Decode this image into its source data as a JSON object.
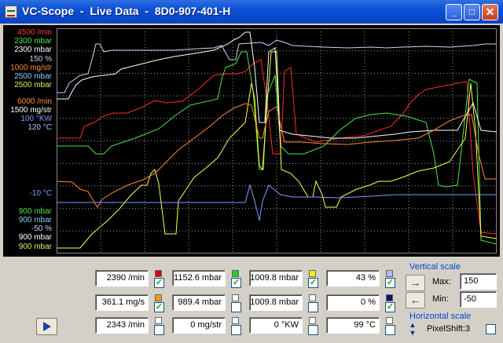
{
  "window": {
    "title": "VC-Scope  -  Live Data  -  8D0-907-401-H",
    "minimize_symbol": "_",
    "maximize_symbol": "□",
    "close_symbol": "✕"
  },
  "scale_labels": [
    {
      "text": "4500 /min",
      "color": "#ff3b3b"
    },
    {
      "text": "2300 mbar",
      "color": "#49e849"
    },
    {
      "text": "2300 mbar",
      "color": "#ffffff"
    },
    {
      "text": "150 %",
      "color": "#d0d0ff"
    },
    {
      "text": "1000 mg/str",
      "color": "#ff8c2a"
    },
    {
      "text": "2500 mbar",
      "color": "#7fd0ff"
    },
    {
      "text": "2500 mbar",
      "color": "#e8e85a"
    },
    {
      "text": "6000 /min",
      "color": "#ff8c2a"
    },
    {
      "text": "1500 mg/str",
      "color": "#ffffff"
    },
    {
      "text": "100 °KW",
      "color": "#7aa0ff"
    },
    {
      "text": "120 °C",
      "color": "#b0c8ff"
    },
    {
      "text": "-10 °C",
      "color": "#7aa0ff"
    },
    {
      "text": "900 mbar",
      "color": "#49e849"
    },
    {
      "text": "900 mbar",
      "color": "#7fd0ff"
    },
    {
      "text": "-50 %",
      "color": "#d0d0ff"
    },
    {
      "text": "900 mbar",
      "color": "#ffffff"
    },
    {
      "text": "900 mbar",
      "color": "#e8e85a"
    }
  ],
  "readouts": [
    {
      "value": "2390 /min",
      "color": "#e00000",
      "checked": true
    },
    {
      "value": "1152.6 mbar",
      "color": "#22d022",
      "checked": true
    },
    {
      "value": "1009.8 mbar",
      "color": "#f0f000",
      "checked": true
    },
    {
      "value": "43 %",
      "color": "#b8b8f0",
      "checked": true
    },
    {
      "value": "361.1 mg/s",
      "color": "#f0a000",
      "checked": true
    },
    {
      "value": "989.4 mbar",
      "color": "#ffffff",
      "checked": false
    },
    {
      "value": "1009.8 mbar",
      "color": "#ffffff",
      "checked": false
    },
    {
      "value": "0 %",
      "color": "#101060",
      "checked": true
    },
    {
      "value": "2343 /min",
      "color": "#ffffff",
      "checked": false
    },
    {
      "value": "0 mg/str",
      "color": "#ffffff",
      "checked": false
    },
    {
      "value": "0 °KW",
      "color": "#ffffff",
      "checked": false
    },
    {
      "value": "99 °C",
      "color": "#ffffff",
      "checked": false
    }
  ],
  "vertical_scale": {
    "title": "Vertical scale",
    "max_label": "Max:",
    "min_label": "Min:",
    "max_value": "150",
    "min_value": "-50"
  },
  "horizontal_scale": {
    "title": "Horizontal scale",
    "pixel_shift": "PixelShift:3"
  },
  "icons": {
    "app": "scope-icon",
    "right_arrow": "→",
    "left_arrow": "←",
    "play": "play-icon"
  },
  "colors": {
    "title_bar": "#0a4fd6",
    "plot_background": "#000000",
    "grid": "#9a9a9a",
    "accent": "#0046d5"
  }
}
